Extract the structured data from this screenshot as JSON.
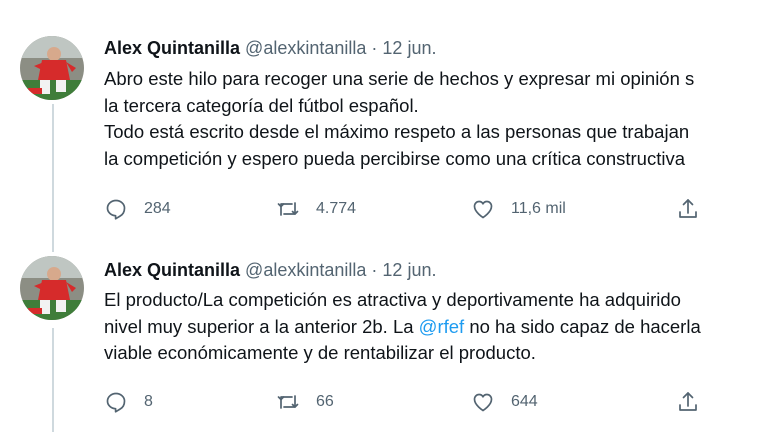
{
  "tweets": [
    {
      "name": "Alex Quintanilla",
      "handle": "@alexkintanilla",
      "separator": "·",
      "date": "12 jun.",
      "lines": [
        "Abro este hilo para recoger una serie de hechos y expresar mi opinión s",
        "la tercera categoría del fútbol español.",
        "Todo está escrito desde el máximo respeto a las personas que trabajan",
        "la competición y espero pueda percibirse como una crítica constructiva"
      ],
      "replies": "284",
      "retweets": "4.774",
      "likes": "11,6 mil"
    },
    {
      "name": "Alex Quintanilla",
      "handle": "@alexkintanilla",
      "separator": "·",
      "date": "12 jun.",
      "line1": "El producto/La competición es atractiva y deportivamente ha adquirido",
      "line2_before": "nivel muy superior a la anterior 2b. La ",
      "line2_mention": "@rfef",
      "line2_after": " no ha sido capaz de hacerla",
      "line3": "viable económicamente y de rentabilizar el producto.",
      "replies": "8",
      "retweets": "66",
      "likes": "644"
    }
  ],
  "icons": {
    "reply": "reply-icon",
    "retweet": "retweet-icon",
    "like": "heart-icon",
    "share": "share-icon"
  },
  "colors": {
    "text": "#0f1419",
    "secondary": "#536471",
    "mention": "#1d9bf0",
    "thread_line": "#cfd9de"
  }
}
